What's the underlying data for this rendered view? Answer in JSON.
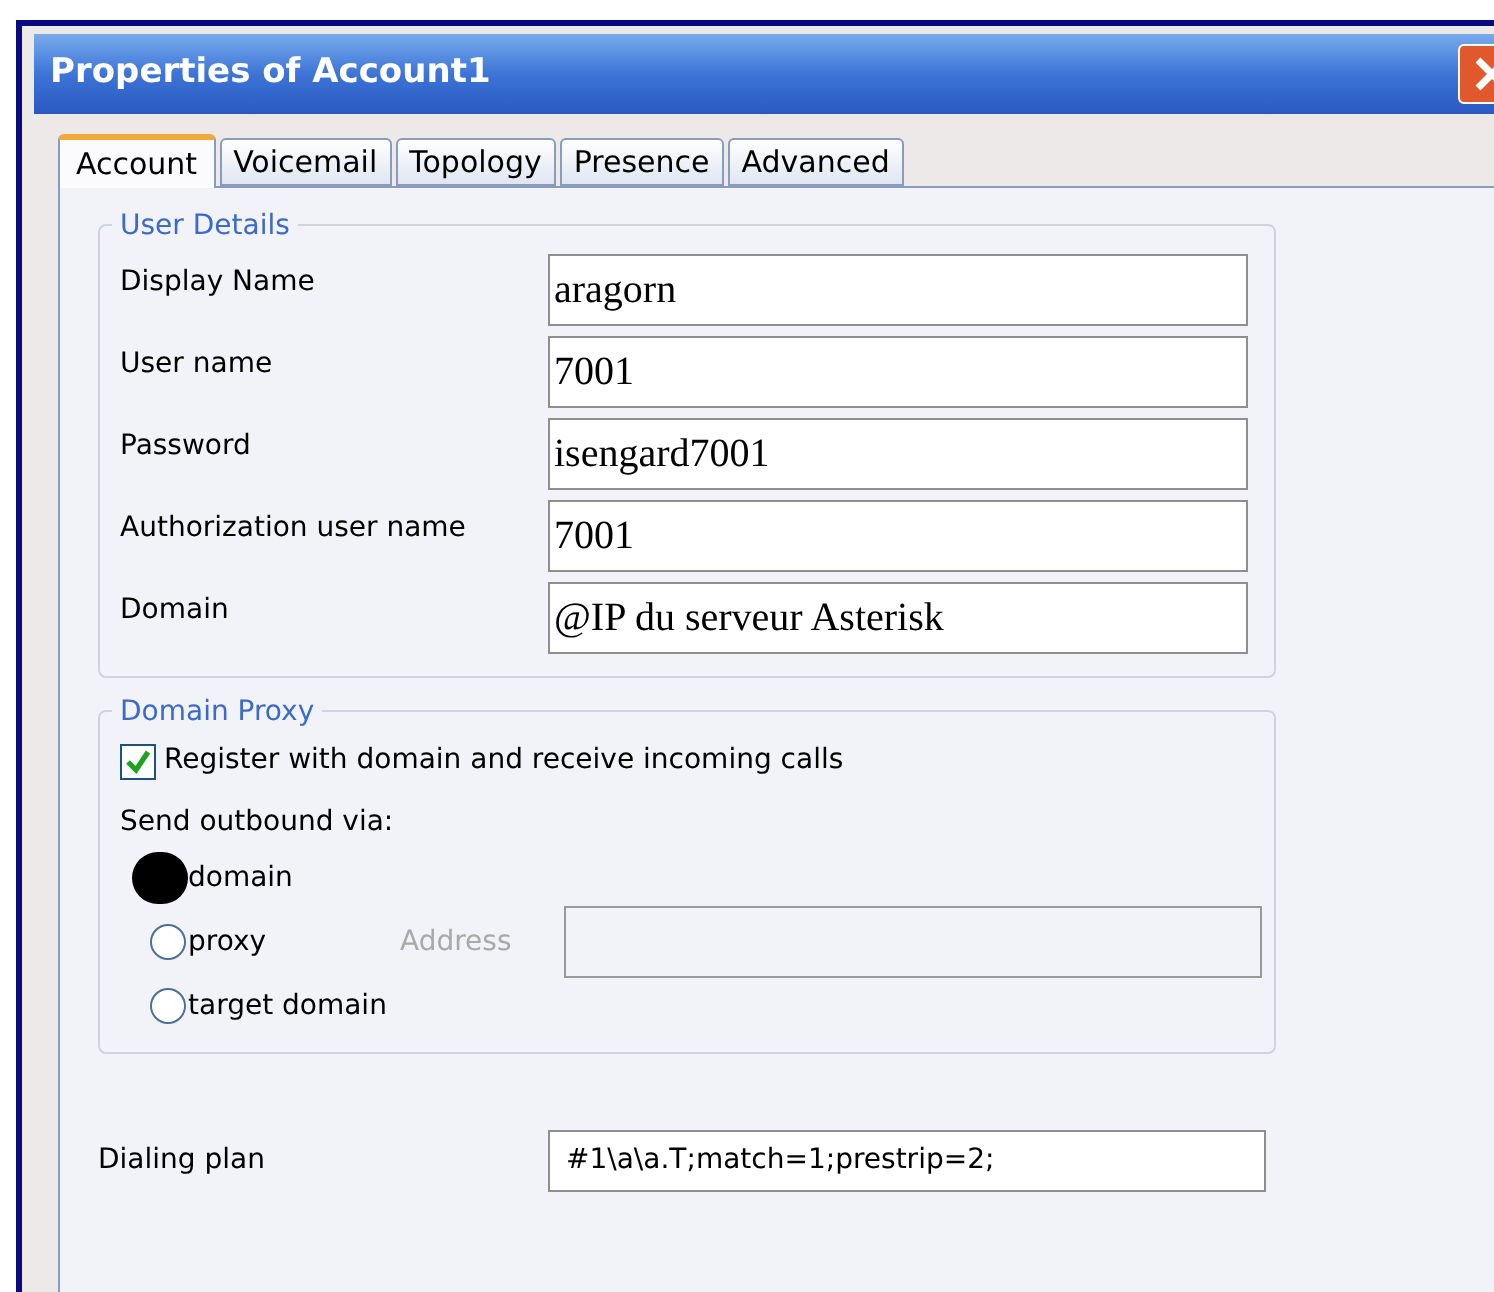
{
  "window": {
    "title": "Properties of Account1"
  },
  "tabs": [
    {
      "label": "Account",
      "selected": true
    },
    {
      "label": "Voicemail",
      "selected": false
    },
    {
      "label": "Topology",
      "selected": false
    },
    {
      "label": "Presence",
      "selected": false
    },
    {
      "label": "Advanced",
      "selected": false
    }
  ],
  "user_details": {
    "title": "User Details",
    "fields": [
      {
        "label": "Display Name",
        "value": "aragorn"
      },
      {
        "label": "User name",
        "value": "7001"
      },
      {
        "label": "Password",
        "value": "isengard7001"
      },
      {
        "label": "Authorization user name",
        "value": "7001"
      },
      {
        "label": "Domain",
        "value": "@IP du serveur Asterisk"
      }
    ]
  },
  "domain_proxy": {
    "title": "Domain Proxy",
    "register": {
      "label": "Register with domain and receive incoming calls",
      "checked": true
    },
    "send_label": "Send outbound via:",
    "options": [
      {
        "label": "domain",
        "selected": true
      },
      {
        "label": "proxy",
        "selected": false
      },
      {
        "label": "target domain",
        "selected": false
      }
    ],
    "address": {
      "label": "Address",
      "disabled": true
    }
  },
  "dialing_plan": {
    "label": "Dialing plan",
    "value": "#1\\a\\a.T;match=1;prestrip=2;"
  }
}
